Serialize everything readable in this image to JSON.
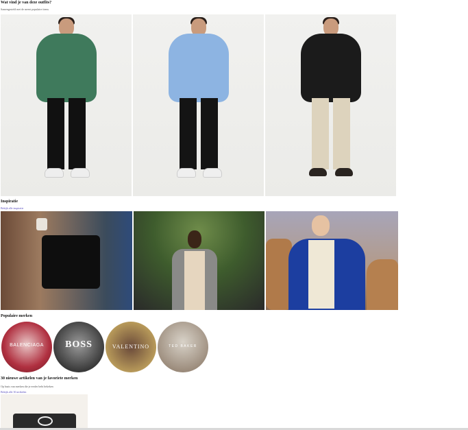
{
  "outfit": {
    "title": "Wat vind je van deze outfits?",
    "subtitle": "Samengesteld met de meest populaire items",
    "looks": [
      {
        "name": "green-puffer-look",
        "jacket": "#3f7a5c",
        "pants": "#111111",
        "shoes": "#eeeeee"
      },
      {
        "name": "blue-puffer-look",
        "jacket": "#8db4e2",
        "pants": "#141414",
        "shoes": "#efefef"
      },
      {
        "name": "black-puffer-look",
        "jacket": "#1b1b1b",
        "pants": "#ddd3bd",
        "shoes": "#2a2420"
      }
    ]
  },
  "inspiration": {
    "title": "Inspiratie",
    "link": "Bekijk alle inspiratie"
  },
  "brands": {
    "title": "Populaire merken",
    "items": [
      {
        "name": "BALENCIAGA",
        "bg": "#b03040"
      },
      {
        "name": "BOSS",
        "bg": "#3a3a3a"
      },
      {
        "name": "VALENTINO",
        "bg": "#b89a5a"
      },
      {
        "name": "TED BAKER",
        "bg": "#9a8a7a"
      }
    ]
  },
  "new_items": {
    "title": "30 nieuwe artikelen van je favoriete merken",
    "subtitle": "Op basis van merken die je eerder hebt bekeken",
    "link": "Bekijk alle 30 artikelen"
  }
}
